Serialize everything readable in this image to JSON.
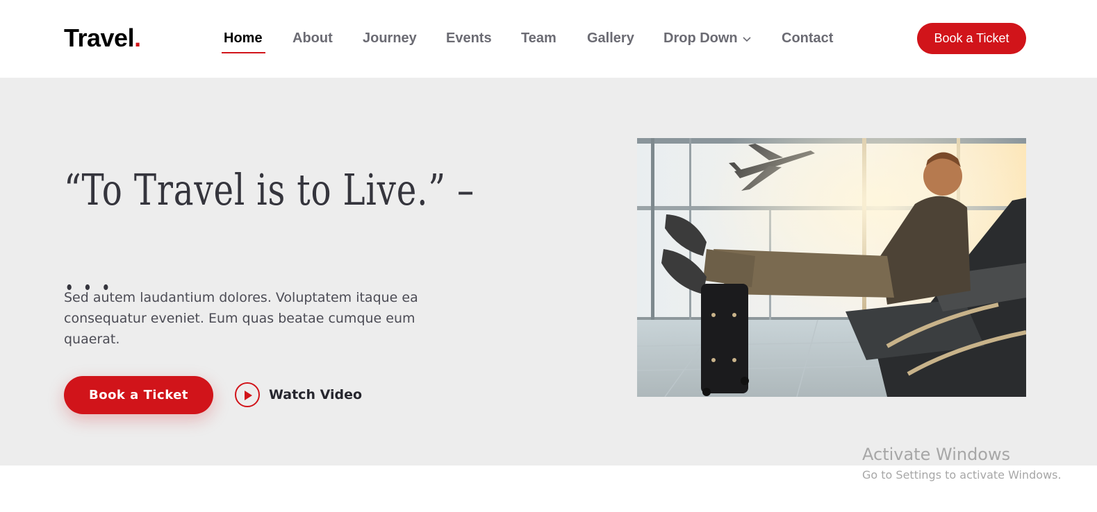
{
  "header": {
    "logo_text": "Travel",
    "logo_dot": ".",
    "nav": [
      {
        "label": "Home",
        "active": true
      },
      {
        "label": "About"
      },
      {
        "label": "Journey"
      },
      {
        "label": "Events"
      },
      {
        "label": "Team"
      },
      {
        "label": "Gallery"
      },
      {
        "label": "Drop Down",
        "has_dropdown": true
      },
      {
        "label": "Contact"
      }
    ],
    "cta_label": "Book a Ticket"
  },
  "hero": {
    "title_line1": "“To Travel is to Live.” –",
    "title_line2": "...",
    "description": "Sed autem laudantium dolores. Voluptatem itaque ea consequatur eveniet. Eum quas beatae cumque eum quaerat.",
    "cta_label": "Book a Ticket",
    "video_label": "Watch Video"
  },
  "watermark": {
    "title": "Activate Windows",
    "subtitle": "Go to Settings to activate Windows."
  },
  "colors": {
    "accent": "#d1141a",
    "hero_bg": "#ededed",
    "nav_text": "#6b6b73"
  },
  "icons": [
    "chevron-down-icon",
    "play-icon"
  ]
}
